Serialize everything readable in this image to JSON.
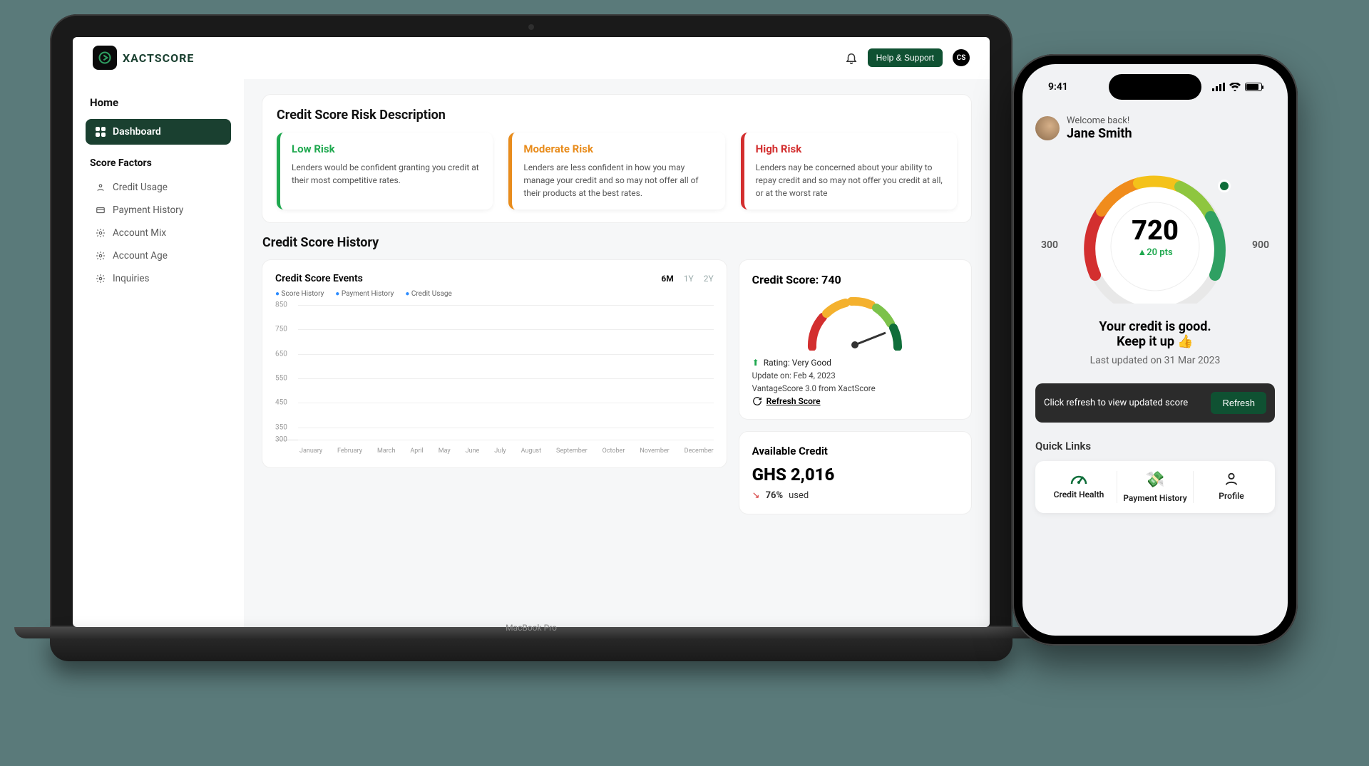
{
  "brand": {
    "name": "XACTSCORE"
  },
  "topbar": {
    "help_label": "Help & Support",
    "avatar_initials": "CS"
  },
  "sidebar": {
    "home_label": "Home",
    "dashboard_label": "Dashboard",
    "score_factors_label": "Score Factors",
    "items": [
      {
        "label": "Credit Usage"
      },
      {
        "label": "Payment History"
      },
      {
        "label": "Account Mix"
      },
      {
        "label": "Account Age"
      },
      {
        "label": "Inquiries"
      }
    ]
  },
  "risk": {
    "section_title": "Credit Score Risk Description",
    "low": {
      "title": "Low Risk",
      "desc": "Lenders would be confident granting you credit at their most competitive rates."
    },
    "mod": {
      "title": "Moderate Risk",
      "desc": "Lenders are less confident in how you may manage your credit and so may not offer all of their products at the best rates."
    },
    "high": {
      "title": "High Risk",
      "desc": "Lenders nay be concerned about your ability to repay credit and so may not offer you credit at all, or at the worst rate"
    }
  },
  "history": {
    "title": "Credit Score History",
    "chart_title": "Credit Score Events",
    "ranges": {
      "m6": "6M",
      "y1": "1Y",
      "y2": "2Y"
    },
    "legend": {
      "a": "Score History",
      "b": "Payment History",
      "c": "Credit Usage"
    }
  },
  "score": {
    "title": "Credit Score: 740",
    "rating": "Rating: Very Good",
    "updated": "Update on: Feb 4, 2023",
    "source": "VantageScore 3.0 from XactScore",
    "refresh": "Refresh Score"
  },
  "available": {
    "title": "Available Credit",
    "value": "GHS 2,016",
    "used_pct": "76%",
    "used_label": "used"
  },
  "laptop": {
    "base_label": "MacBook Pro"
  },
  "mobile": {
    "time": "9:41",
    "welcome": "Welcome back!",
    "name": "Jane Smith",
    "score": "720",
    "delta": "▲20 pts",
    "min": "300",
    "max": "900",
    "status1": "Your credit is good.",
    "status2": "Keep it up 👍",
    "updated": "Last updated on 31 Mar 2023",
    "refresh_prompt": "Click refresh to view updated score",
    "refresh_btn": "Refresh",
    "ql_title": "Quick Links",
    "ql": {
      "a": "Credit Health",
      "b": "Payment History",
      "c": "Profile"
    }
  },
  "chart_data": {
    "type": "line",
    "title": "Credit Score Events",
    "ylabel": "",
    "ylim": [
      300,
      850
    ],
    "y_ticks": [
      300,
      350,
      450,
      550,
      650,
      750,
      850
    ],
    "categories": [
      "January",
      "February",
      "March",
      "April",
      "May",
      "June",
      "July",
      "August",
      "September",
      "October",
      "November",
      "December"
    ],
    "series": [
      {
        "name": "Score History",
        "values": [
          null,
          null,
          null,
          null,
          null,
          null,
          null,
          null,
          null,
          null,
          null,
          null
        ]
      },
      {
        "name": "Payment History",
        "values": [
          null,
          null,
          null,
          null,
          null,
          null,
          null,
          null,
          null,
          null,
          null,
          null
        ]
      },
      {
        "name": "Credit Usage",
        "values": [
          null,
          null,
          null,
          null,
          null,
          null,
          null,
          null,
          null,
          null,
          null,
          null
        ]
      }
    ]
  }
}
